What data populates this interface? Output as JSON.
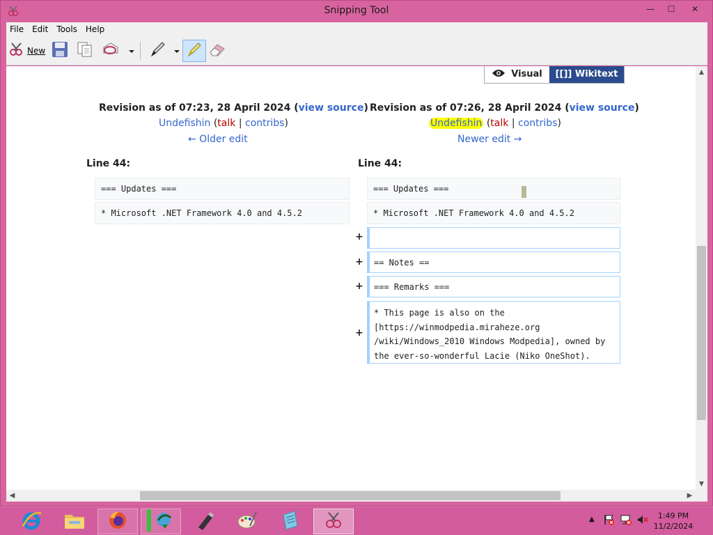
{
  "window": {
    "title": "Snipping Tool",
    "minimize_glyph": "—",
    "maximize_glyph": "☐",
    "close_glyph": "✕"
  },
  "menu": [
    "File",
    "Edit",
    "Tools",
    "Help"
  ],
  "toolbar": {
    "new_label": "New",
    "icons": [
      "scissors-icon",
      "save-icon",
      "copy-icon",
      "send-snip-icon",
      "dropdown-arrow-icon",
      "pen-icon",
      "highlighter-icon",
      "eraser-icon"
    ],
    "active_tool": "highlighter-icon"
  },
  "diff": {
    "toggle": {
      "visual": "Visual",
      "wikitext": "[[]] Wikitext"
    },
    "left": {
      "revision_prefix": "Revision as of 07:23, 28 April 2024 (",
      "view_source": "view source",
      "revision_suffix": ")",
      "user": "Undefishin",
      "talk": "talk",
      "contribs": "contribs",
      "nav": "← Older edit",
      "line_label": "Line 44:",
      "lines": [
        "=== Updates ===",
        "* Microsoft .NET Framework 4.0 and 4.5.2"
      ]
    },
    "right": {
      "revision_prefix": "Revision as of 07:26, 28 April 2024 (",
      "view_source": "view source",
      "revision_suffix": ")",
      "user": "Undefishin",
      "talk": "talk",
      "contribs": "contribs",
      "nav": "Newer edit →",
      "line_label": "Line 44:",
      "lines": [
        "=== Updates ===",
        "* Microsoft .NET Framework 4.0 and 4.5.2"
      ],
      "added": [
        "",
        "== Notes ==",
        "=== Remarks ===",
        "* This page is also on the [https://winmodpedia.miraheze.org /wiki/Windows_2010 Windows Modpedia], owned by the ever-so-wonderful Lacie (Niko OneShot)."
      ],
      "added_wrapped_lines": [
        "* This page is also on the",
        "[https://winmodpedia.miraheze.org",
        "/wiki/Windows_2010 Windows Modpedia], owned by",
        "the ever-so-wonderful Lacie (Niko OneShot)."
      ],
      "plus_marker": "+"
    },
    "separators": {
      "open": " (",
      "pipe": " | ",
      "close": ")"
    },
    "highlighted_user": "Undefishin"
  },
  "taskbar": {
    "apps": [
      "internet-explorer-icon",
      "file-explorer-icon",
      "firefox-icon",
      "download-manager-icon",
      "usb-drive-icon",
      "paint-icon",
      "notepad-icon",
      "snipping-tool-icon"
    ],
    "active_app": "snipping-tool-icon",
    "clock_time": "1:49 PM",
    "clock_date": "11/2/2024"
  },
  "colors": {
    "frame": "#d8649f",
    "link": "#3366cc",
    "redlink": "#ba0000",
    "added_border": "#a3d3ff",
    "wikitext_button": "#2a4b8d",
    "highlight": "#ffff00"
  }
}
